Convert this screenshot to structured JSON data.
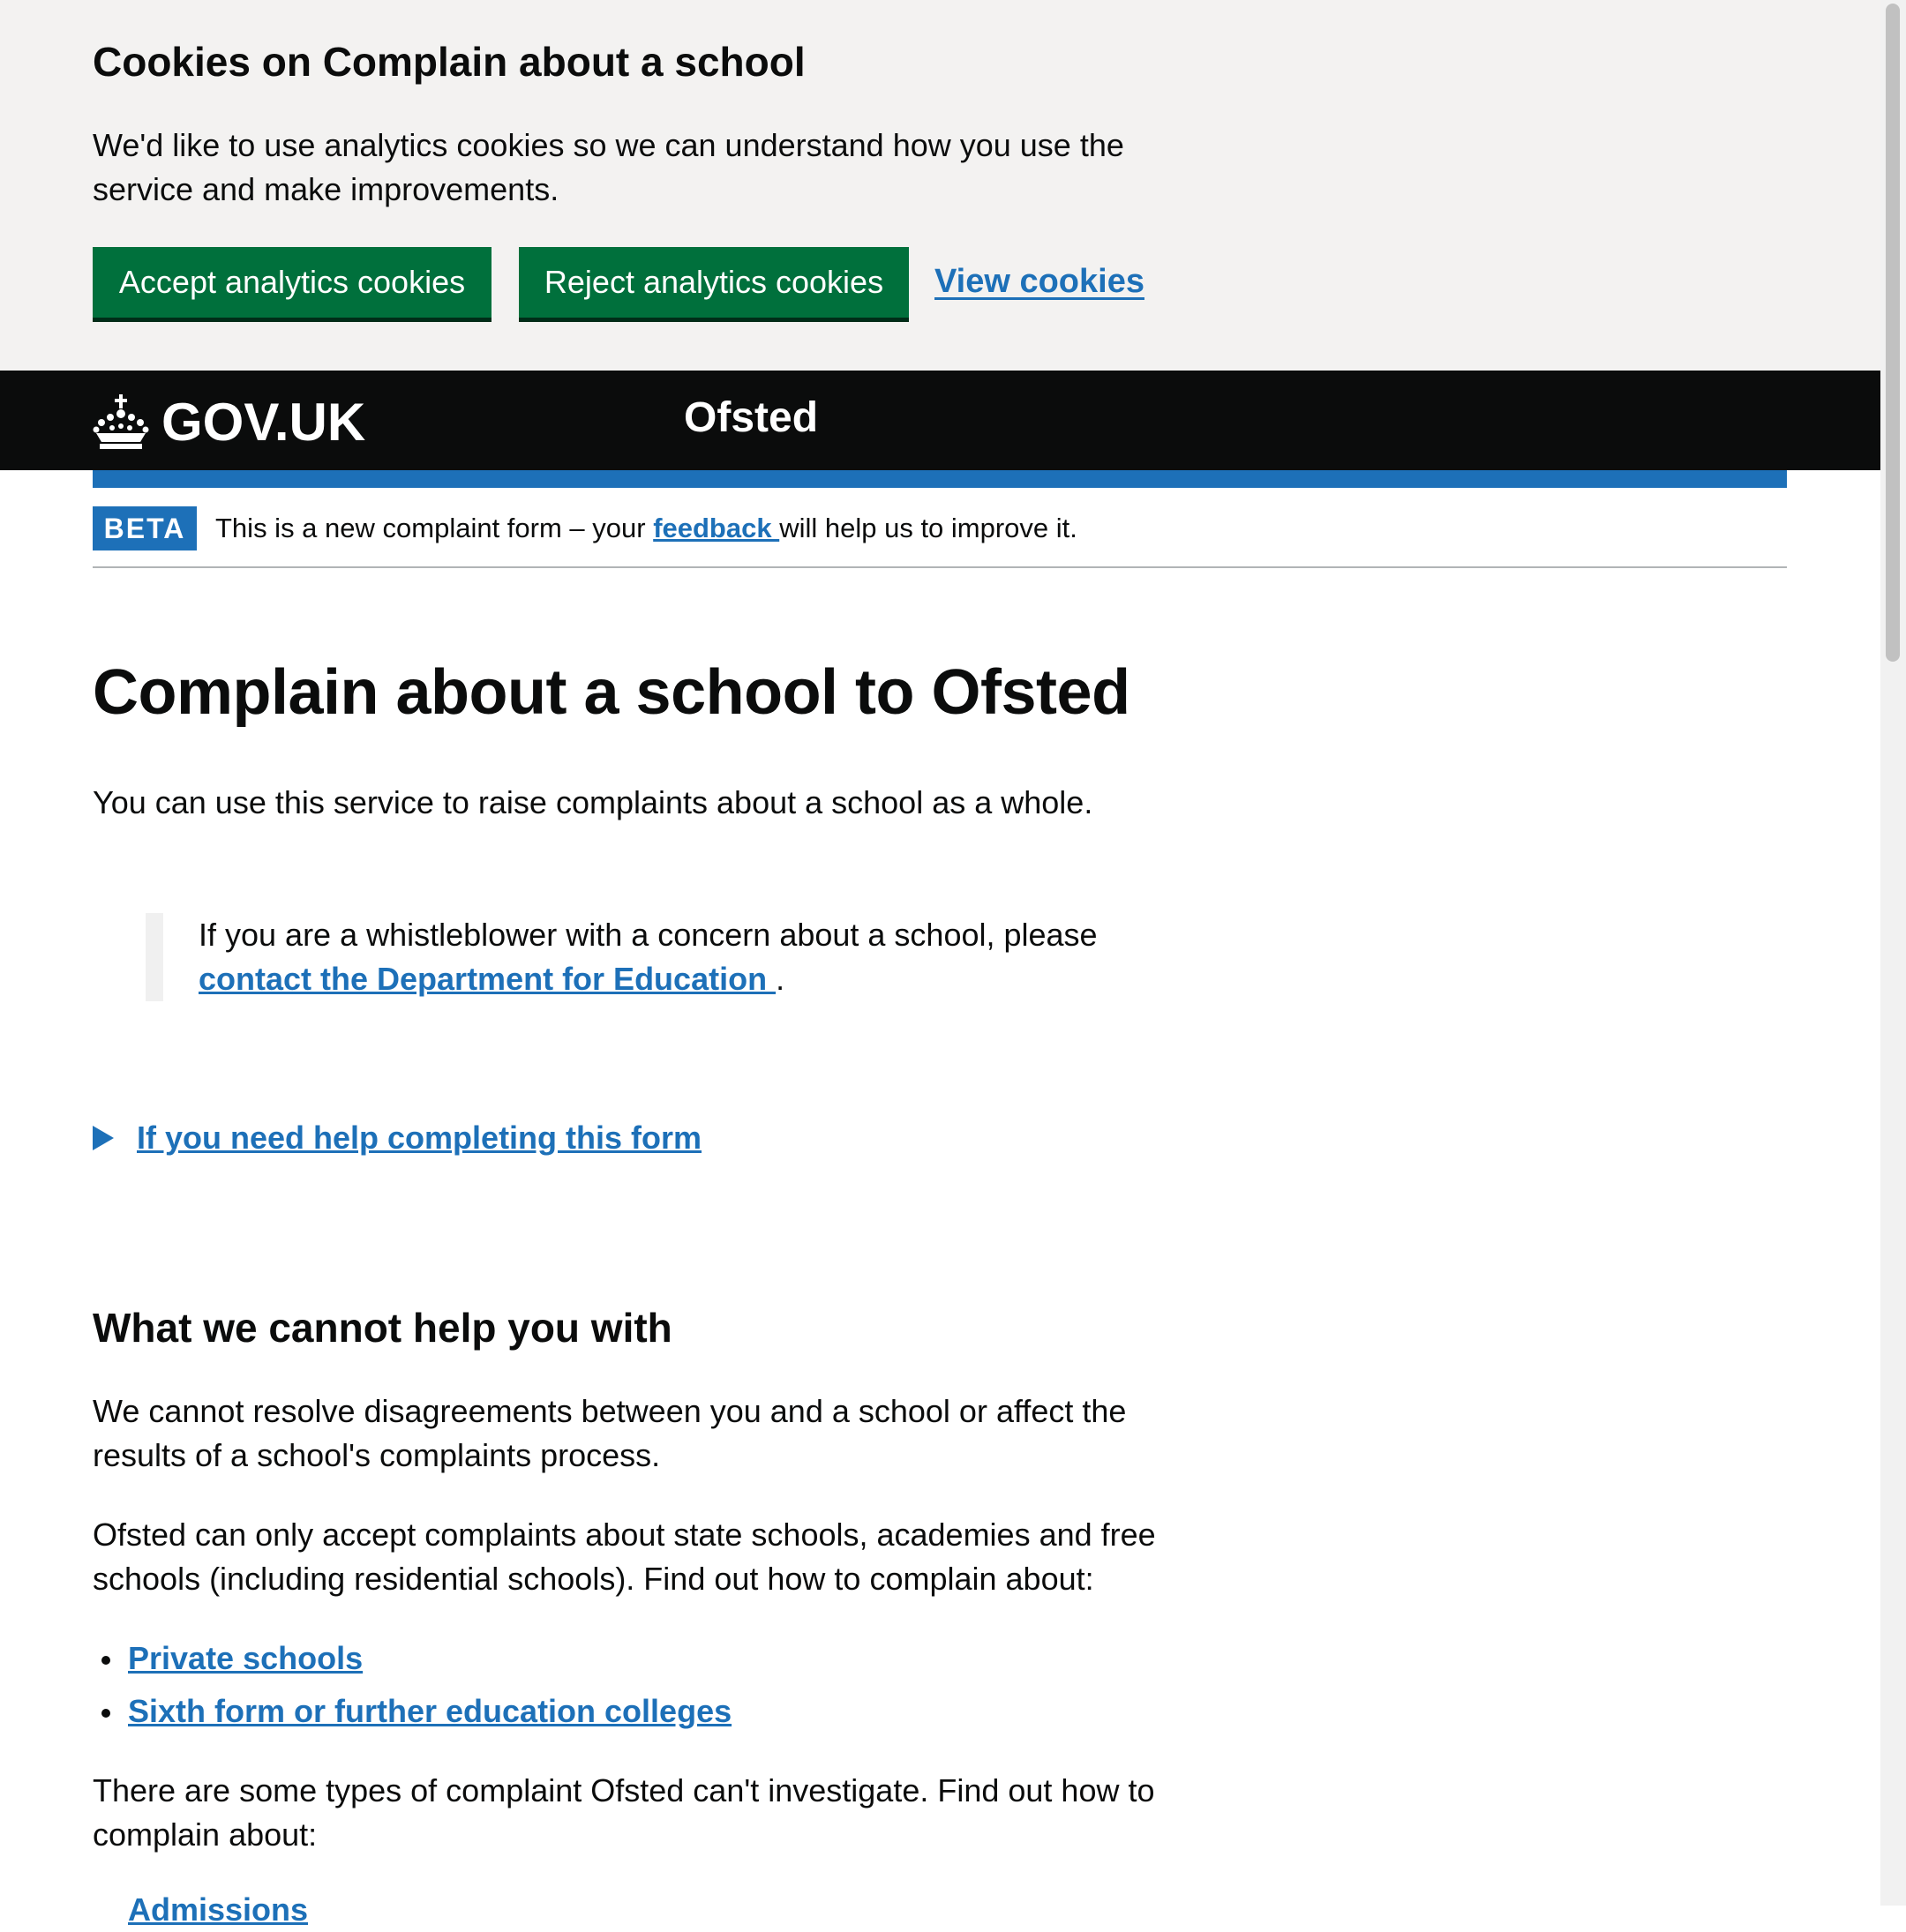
{
  "cookie_banner": {
    "title": "Cookies on Complain about a school",
    "text": "We'd like to use analytics cookies so we can understand how you use the service and make improvements.",
    "accept_label": "Accept analytics cookies",
    "reject_label": "Reject analytics cookies",
    "view_label": "View cookies"
  },
  "header": {
    "logo_text": "GOV.UK",
    "service_name": "Ofsted",
    "logo_icon": "crown-icon"
  },
  "phase_banner": {
    "tag": "BETA",
    "text_before": "This is a new complaint form – your ",
    "link": "feedback ",
    "text_after": "will help us to improve it."
  },
  "main": {
    "title": "Complain about a school to Ofsted",
    "intro": "You can use this service to raise complaints about a school as a whole.",
    "inset_text": "If you are a whistleblower with a concern about a school, please ",
    "inset_link": "contact the Department for Education ",
    "inset_end": ".",
    "details_summary": "If you need help completing this form",
    "heading": "What we cannot help you with",
    "para1": "We cannot resolve disagreements between you and a school or affect the results of a school's complaints process.",
    "para2": "Ofsted can only accept complaints about state schools, academies and free schools (including residential schools). Find out how to complain about:",
    "links": [
      "Private schools",
      "Sixth form or further education colleges"
    ],
    "para3": "There are some types of complaint Ofsted can't investigate. Find out how to complain about:",
    "cutoff_link": "Admissions"
  },
  "colors": {
    "button_green": "#00703c",
    "link_blue": "#1d70b8",
    "header_black": "#0b0c0c",
    "banner_grey": "#f3f2f1"
  }
}
